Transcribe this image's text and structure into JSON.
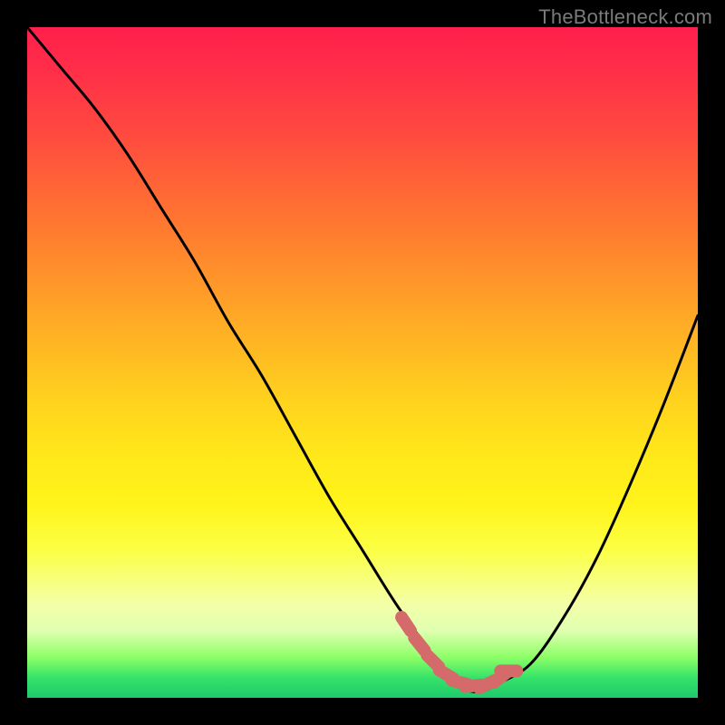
{
  "watermark": "TheBottleneck.com",
  "colors": {
    "background": "#000000",
    "curve": "#000000",
    "marker": "#d46a6a",
    "gradient_stops": [
      "#ff1f4b",
      "#ff4a3f",
      "#ff7a2f",
      "#ffa427",
      "#ffd01e",
      "#ffe81a",
      "#fbff45",
      "#f4ffa8",
      "#8cff66",
      "#35e36a",
      "#1ec96b"
    ]
  },
  "chart_data": {
    "type": "line",
    "title": "",
    "xlabel": "",
    "ylabel": "",
    "xlim": [
      0,
      100
    ],
    "ylim": [
      0,
      100
    ],
    "series": [
      {
        "name": "bottleneck-curve",
        "x": [
          0,
          5,
          10,
          15,
          20,
          25,
          30,
          35,
          40,
          45,
          50,
          55,
          60,
          62,
          64,
          66,
          68,
          70,
          75,
          80,
          85,
          90,
          95,
          100
        ],
        "values": [
          100,
          94,
          88,
          81,
          73,
          65,
          56,
          48,
          39,
          30,
          22,
          14,
          7,
          4,
          2,
          1,
          1,
          2,
          5,
          12,
          21,
          32,
          44,
          57
        ]
      }
    ],
    "markers": {
      "name": "highlight-dots",
      "x": [
        56.5,
        58.5,
        60.5,
        62.5,
        64.5,
        66.5,
        68.5,
        70.5,
        71.8
      ],
      "values": [
        11.0,
        8.0,
        5.5,
        3.5,
        2.3,
        1.8,
        2.0,
        3.0,
        4.0
      ]
    }
  }
}
